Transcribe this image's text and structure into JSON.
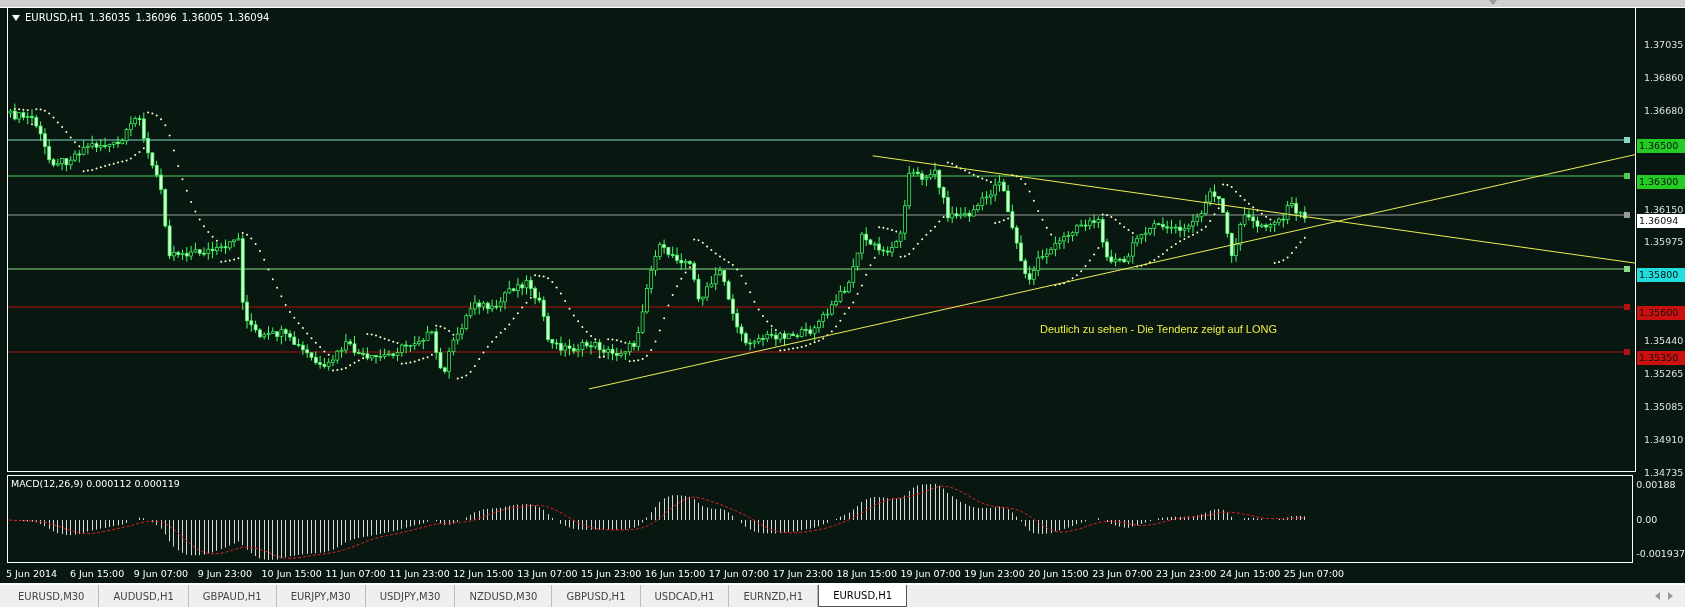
{
  "header": {
    "symbol": "EURUSD,H1",
    "values": [
      "1.36035",
      "1.36096",
      "1.36005",
      "1.36094"
    ]
  },
  "price_axis": [
    "1.37035",
    "1.36860",
    "1.36680",
    "1.36150",
    "1.35975",
    "1.35440",
    "1.35265",
    "1.35085",
    "1.34910",
    "1.34735"
  ],
  "levels": [
    {
      "label": "1.36500",
      "color": "#22cc22"
    },
    {
      "label": "1.36300",
      "color": "#22cc22"
    },
    {
      "label": "1.36094",
      "color": "#ffffff"
    },
    {
      "label": "1.35800",
      "color": "#22dddd"
    },
    {
      "label": "1.35600",
      "color": "#cc1010"
    },
    {
      "label": "1.35350",
      "color": "#cc1010"
    }
  ],
  "annotation": "Deutlich zu sehen - Die Tendenz zeigt auf LONG",
  "macd": {
    "title": "MACD(12,26,9) 0.000112 0.000119",
    "axis": [
      "0.00188",
      "0.00",
      "-0.001937"
    ]
  },
  "time_axis": [
    "5 Jun 2014",
    "6 Jun 15:00",
    "9 Jun 07:00",
    "9 Jun 23:00",
    "10 Jun 15:00",
    "11 Jun 07:00",
    "11 Jun 23:00",
    "12 Jun 15:00",
    "13 Jun 07:00",
    "15 Jun 23:00",
    "16 Jun 15:00",
    "17 Jun 07:00",
    "17 Jun 23:00",
    "18 Jun 15:00",
    "19 Jun 07:00",
    "19 Jun 23:00",
    "20 Jun 15:00",
    "23 Jun 07:00",
    "23 Jun 23:00",
    "24 Jun 15:00",
    "25 Jun 07:00"
  ],
  "tabs": [
    {
      "label": "EURUSD,M30",
      "selected": false
    },
    {
      "label": "AUDUSD,H1",
      "selected": false
    },
    {
      "label": "GBPAUD,H1",
      "selected": false
    },
    {
      "label": "EURJPY,M30",
      "selected": false
    },
    {
      "label": "USDJPY,M30",
      "selected": false
    },
    {
      "label": "NZDUSD,M30",
      "selected": false
    },
    {
      "label": "GBPUSD,H1",
      "selected": false
    },
    {
      "label": "USDCAD,H1",
      "selected": false
    },
    {
      "label": "EURNZD,H1",
      "selected": false
    },
    {
      "label": "EURUSD,H1",
      "selected": true
    }
  ]
}
